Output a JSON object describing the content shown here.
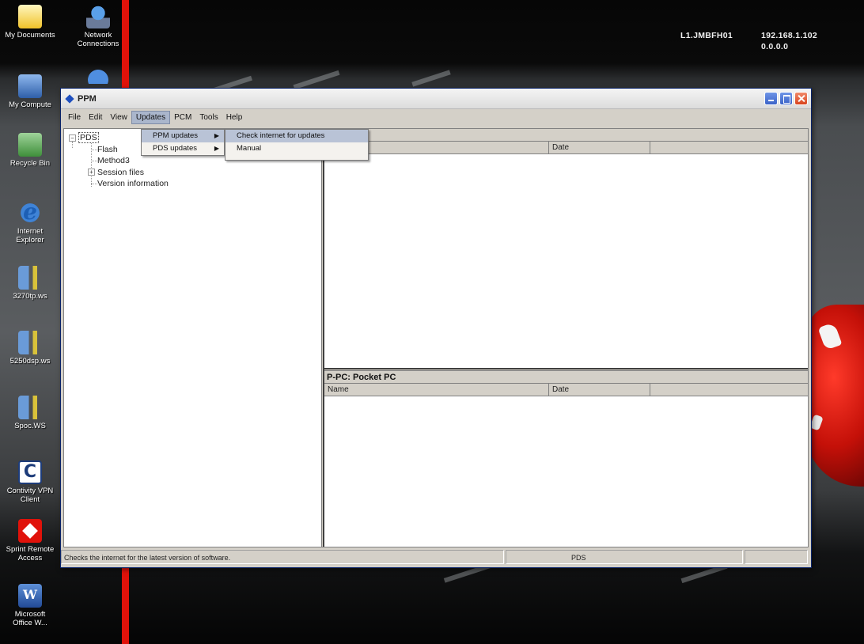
{
  "desktop": {
    "ip_label": "L1.JMBFH01",
    "ip_addr": "192.168.1.102",
    "ip_mask": "0.0.0.0",
    "icons": [
      {
        "label": "My Documents",
        "icon": "folder-icon"
      },
      {
        "label": "Network\nConnections",
        "icon": "network-icon"
      },
      {
        "label": "My Compute",
        "icon": "computer-icon"
      },
      {
        "label": "Recycle Bin",
        "icon": "recycle-bin-icon"
      },
      {
        "label": "Internet\nExplorer",
        "icon": "internet-explorer-icon"
      },
      {
        "label": "3270tp.ws",
        "icon": "shortcut-icon"
      },
      {
        "label": "5250dsp.ws",
        "icon": "shortcut-icon"
      },
      {
        "label": "Spoc.WS",
        "icon": "shortcut-icon"
      },
      {
        "label": "Contivity VPN\nClient",
        "icon": "vpn-client-icon"
      },
      {
        "label": "Sprint Remote\nAccess",
        "icon": "sprint-icon"
      },
      {
        "label": "Microsoft\nOffice W...",
        "icon": "word-icon"
      }
    ]
  },
  "window": {
    "title": "PPM",
    "menu": [
      "File",
      "Edit",
      "View",
      "Updates",
      "PCM",
      "Tools",
      "Help"
    ],
    "tree": {
      "root": "PDS",
      "children": [
        "Flash",
        "Method3",
        "Session files",
        "Version information"
      ]
    },
    "top_panel": {
      "columns": [
        "",
        "Date",
        ""
      ]
    },
    "bottom_panel": {
      "title": "P-PC: Pocket PC",
      "columns": [
        "Name",
        "Date",
        ""
      ]
    },
    "status": {
      "message": "Checks the internet for the latest version of software.",
      "mode": "PDS"
    }
  },
  "updates_menu": {
    "items": [
      "PPM updates",
      "PDS updates"
    ],
    "submenu": [
      "Check internet for updates",
      "Manual"
    ]
  },
  "colors": {
    "title_close": "#d8431e",
    "menu_highlight": "#b9c3d6",
    "accent_stripe": "#e0120a"
  }
}
